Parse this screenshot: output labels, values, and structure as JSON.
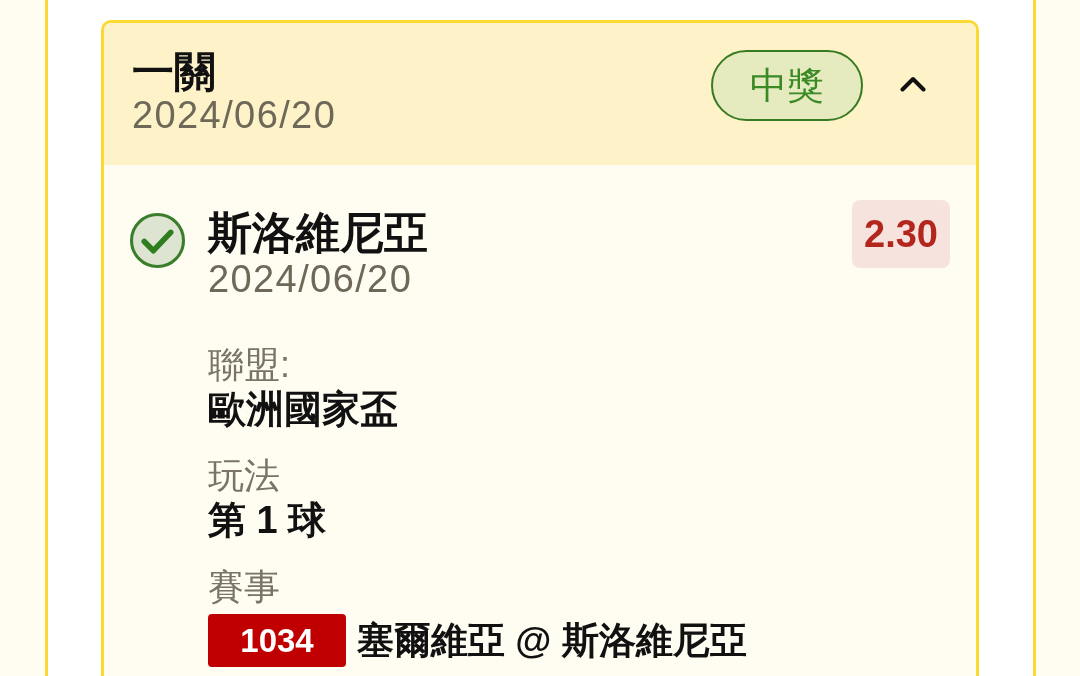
{
  "bet": {
    "title": "一關",
    "date": "2024/06/20",
    "status": {
      "label": "中獎",
      "kind": "won"
    },
    "expanded": true,
    "selections": [
      {
        "won": true,
        "name": "斯洛維尼亞",
        "date": "2024/06/20",
        "odds": "2.30",
        "details": [
          {
            "kind": "text",
            "label": "聯盟:",
            "value": "歐洲國家盃"
          },
          {
            "kind": "text",
            "label": "玩法",
            "value": "第 1 球"
          },
          {
            "kind": "match",
            "label": "賽事",
            "match_no": "1034",
            "value": "塞爾維亞 @ 斯洛維尼亞"
          }
        ]
      }
    ]
  }
}
